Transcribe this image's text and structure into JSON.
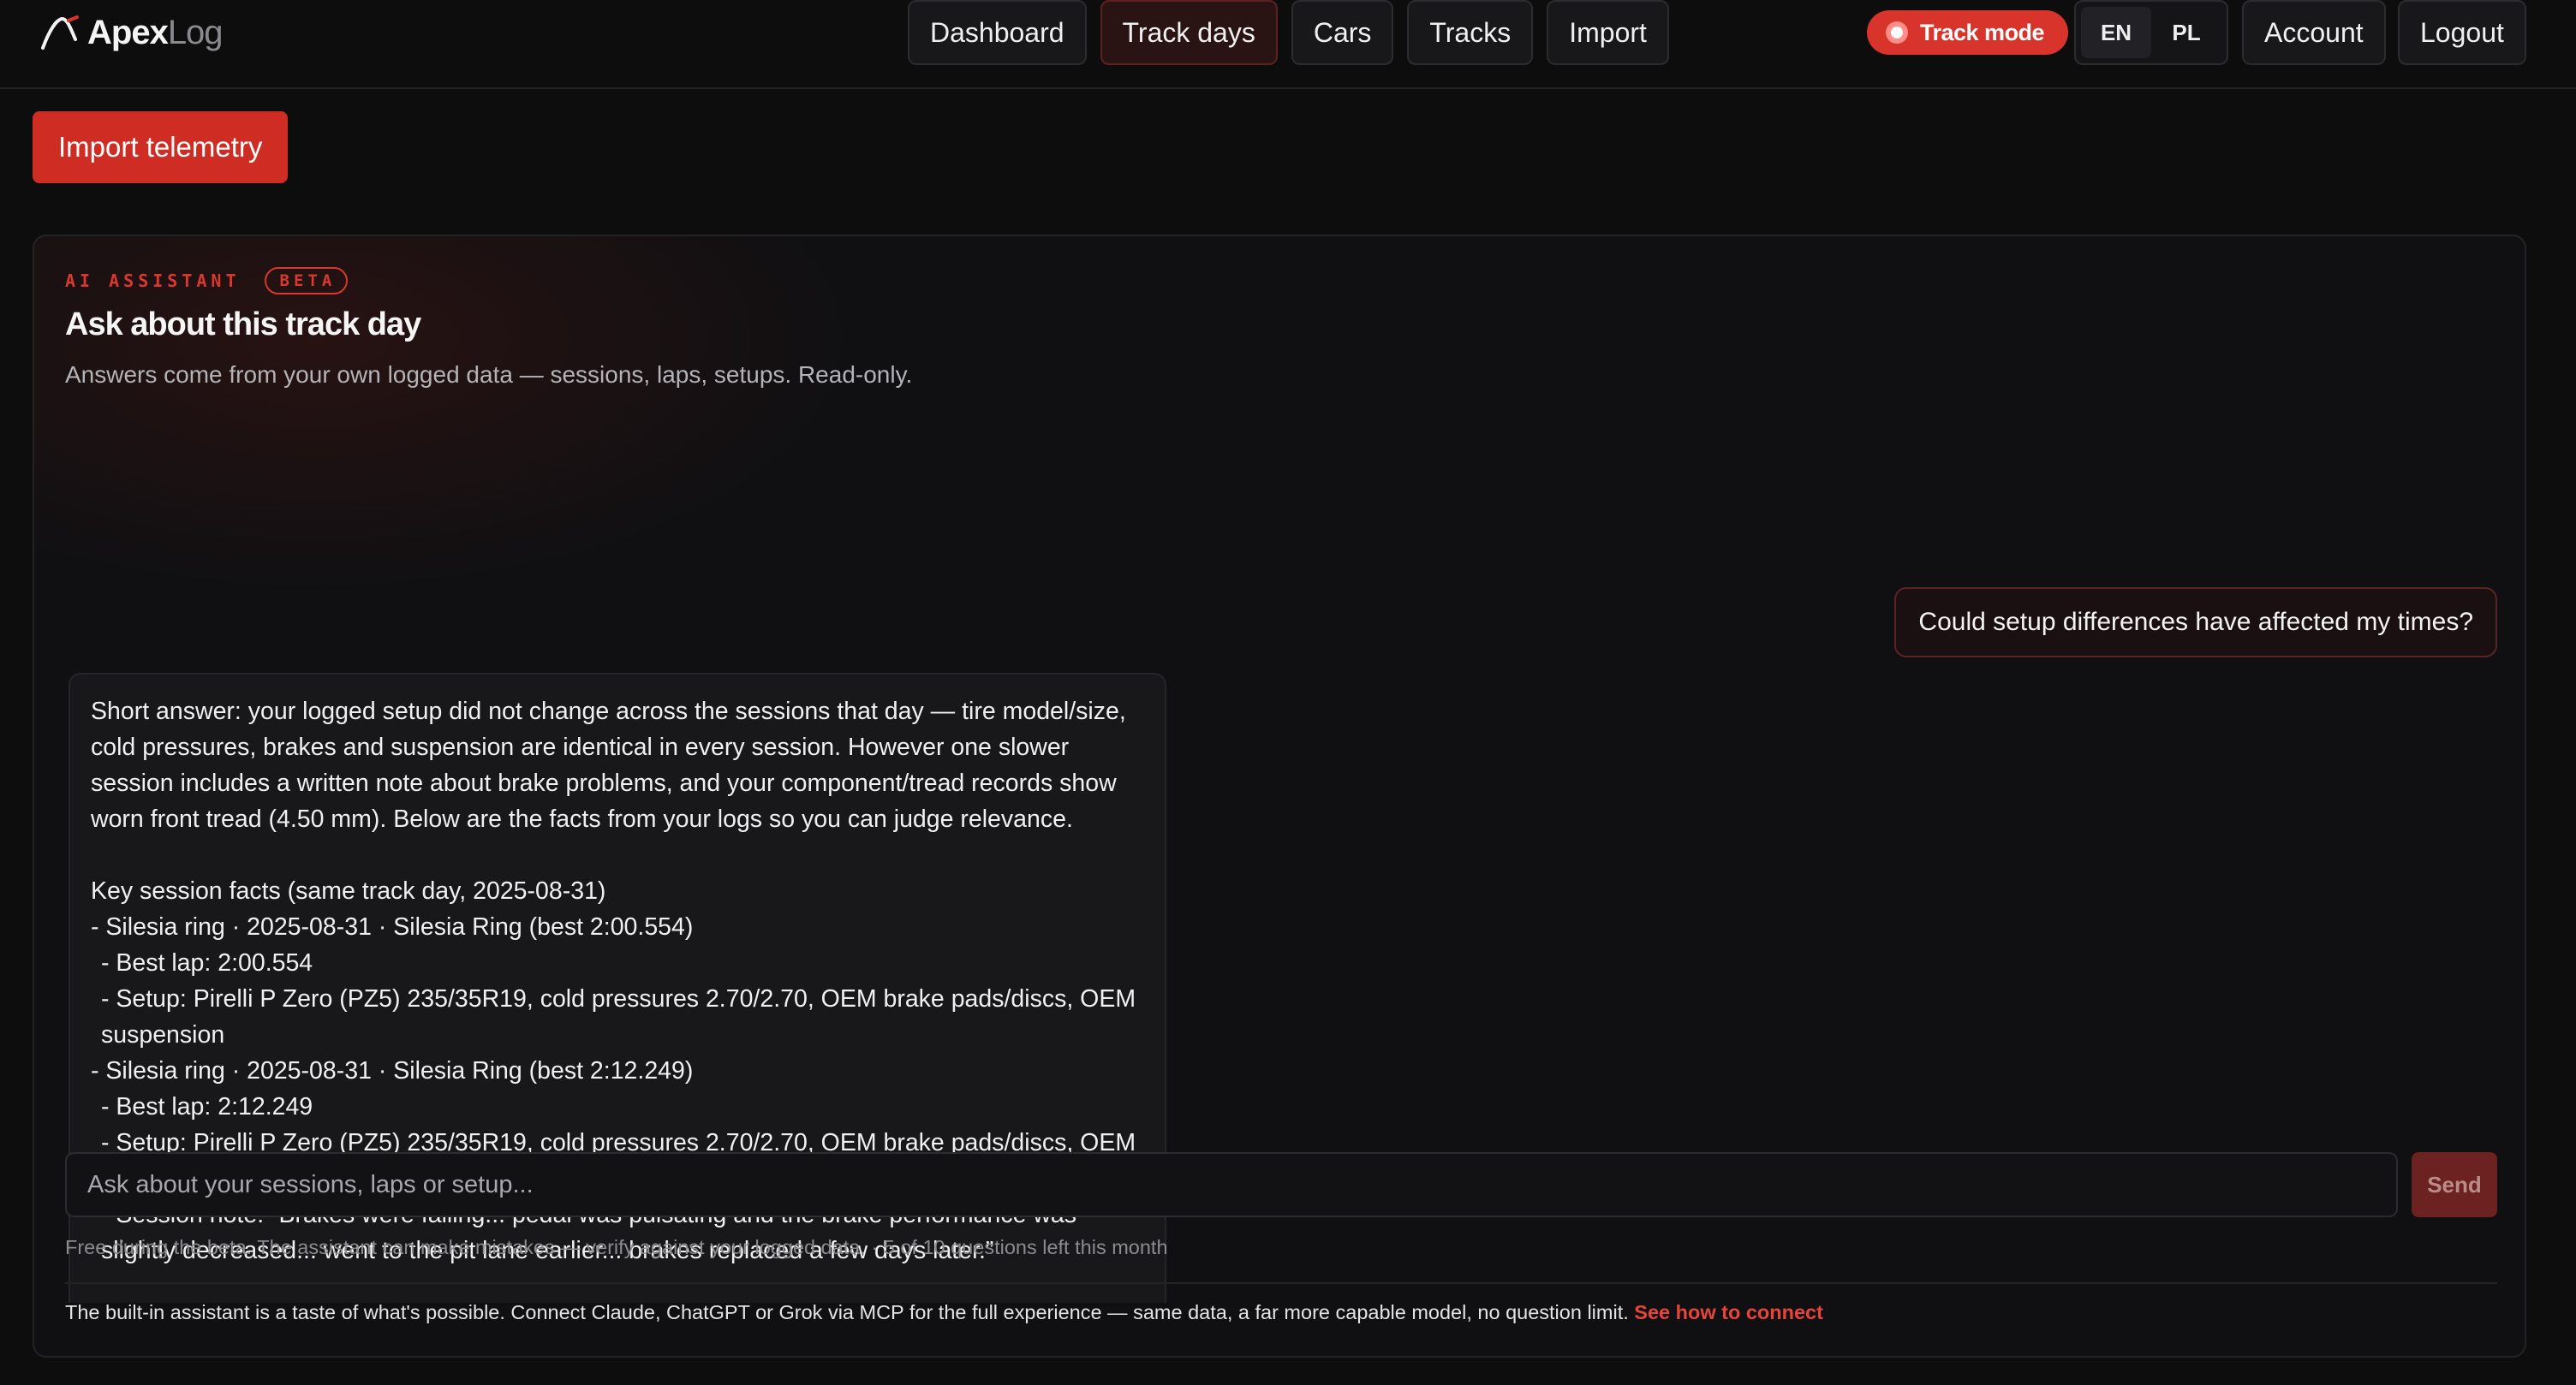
{
  "app": {
    "logo_main": "Apex",
    "logo_light": "Log",
    "logo_icon": "swoosh-icon"
  },
  "nav": {
    "items": [
      {
        "label": "Dashboard"
      },
      {
        "label": "Track days"
      },
      {
        "label": "Cars"
      },
      {
        "label": "Tracks"
      },
      {
        "label": "Import"
      }
    ],
    "active": "Track days"
  },
  "header": {
    "track_mode_label": "Track mode",
    "lang_en": "EN",
    "lang_pl": "PL",
    "lang_active": "EN",
    "account_label": "Account",
    "logout_label": "Logout"
  },
  "actions": {
    "import_label": "Import telemetry"
  },
  "assistant": {
    "eyebrow": "AI ASSISTANT",
    "badge": "BETA",
    "title": "Ask about this track day",
    "subtitle": "Answers come from your own logged data — sessions, laps, setups. Read-only.",
    "user_message": "Could setup differences have affected my times?",
    "reply": {
      "intro": "Short answer: your logged setup did not change across the sessions that day — tire model/size, cold pressures, brakes and suspension are identical in every session. However one slower session includes a written note about brake problems, and your component/tread records show worn front tread (4.50 mm). Below are the facts from your logs so you can judge relevance.",
      "heading": "Key session facts (same track day, 2025-08-31)",
      "s1": "- Silesia ring · 2025-08-31 · Silesia Ring (best 2:00.554)",
      "s1_best": "- Best lap: 2:00.554",
      "s1_setup": "- Setup: Pirelli P Zero (PZ5) 235/35R19, cold pressures 2.70/2.70, OEM brake pads/discs, OEM suspension",
      "s2": "- Silesia ring · 2025-08-31 · Silesia Ring (best 2:12.249)",
      "s2_best": "- Best lap: 2:12.249",
      "s2_setup": "- Setup: Pirelli P Zero (PZ5) 235/35R19, cold pressures 2.70/2.70, OEM brake pads/discs, OEM suspension",
      "s2_note": "- Session note: “Brakes were failing... pedal was pulsating and the brake performance was slightly decreased... went to the pit lane earlier... brakes replaced a few days later.”"
    },
    "input_placeholder": "Ask about your sessions, laps or setup...",
    "send_label": "Send",
    "disclaimer": "Free during the beta. The assistant can make mistakes — verify against your logged data. · 5 of 10 questions left this month",
    "mcp_note": "The built-in assistant is a taste of what's possible. Connect Claude, ChatGPT or Grok via MCP for the full experience — same data, a far more capable model, no question limit.",
    "mcp_link": "See how to connect"
  },
  "colors": {
    "accent": "#d9342b",
    "background": "#0d0d0e",
    "panel": "#101012"
  }
}
